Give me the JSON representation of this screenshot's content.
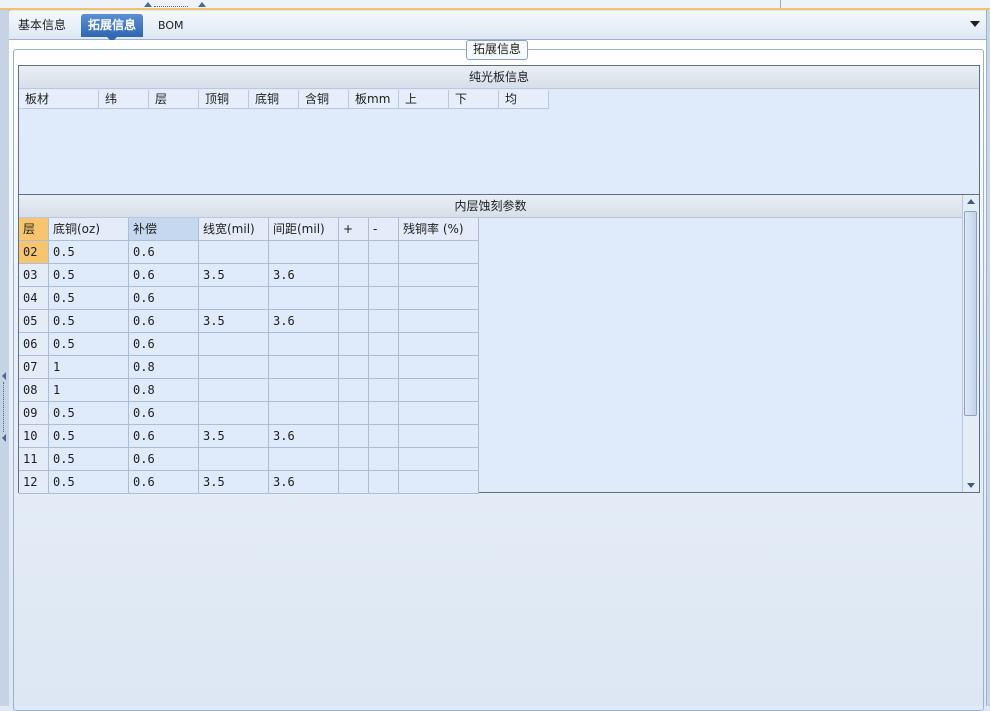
{
  "tabs": [
    {
      "label": "基本信息",
      "active": false
    },
    {
      "label": "拓展信息",
      "active": true
    },
    {
      "label": "BOM",
      "active": false
    }
  ],
  "group_title": "拓展信息",
  "plain_board": {
    "title": "纯光板信息",
    "columns": [
      "板材",
      "纬",
      "层",
      "顶铜",
      "底铜",
      "含铜",
      "板mm",
      "上",
      "下",
      "均"
    ]
  },
  "inner_etch": {
    "title": "内层蚀刻参数",
    "columns": [
      "层",
      "底铜(oz)",
      "补偿",
      "线宽(mil)",
      "间距(mil)",
      "+",
      "-",
      "残铜率 (%)"
    ],
    "rows": [
      [
        "02",
        "0.5",
        "0.6",
        "",
        "",
        "",
        "",
        ""
      ],
      [
        "03",
        "0.5",
        "0.6",
        "3.5",
        "3.6",
        "",
        "",
        ""
      ],
      [
        "04",
        "0.5",
        "0.6",
        "",
        "",
        "",
        "",
        ""
      ],
      [
        "05",
        "0.5",
        "0.6",
        "3.5",
        "3.6",
        "",
        "",
        ""
      ],
      [
        "06",
        "0.5",
        "0.6",
        "",
        "",
        "",
        "",
        ""
      ],
      [
        "07",
        "1",
        "0.8",
        "",
        "",
        "",
        "",
        ""
      ],
      [
        "08",
        "1",
        "0.8",
        "",
        "",
        "",
        "",
        ""
      ],
      [
        "09",
        "0.5",
        "0.6",
        "",
        "",
        "",
        "",
        ""
      ],
      [
        "10",
        "0.5",
        "0.6",
        "3.5",
        "3.6",
        "",
        "",
        ""
      ],
      [
        "11",
        "0.5",
        "0.6",
        "",
        "",
        "",
        "",
        ""
      ],
      [
        "12",
        "0.5",
        "0.6",
        "3.5",
        "3.6",
        "",
        "",
        ""
      ]
    ]
  },
  "colors": {
    "accent": "#2f65b3",
    "selected_cell": "#f7c56d",
    "grid_bg": "#dfeafb"
  },
  "icons": [
    "dropdown-arrow-icon",
    "scroll-up-icon",
    "scroll-down-icon",
    "collapse-left-icon"
  ]
}
